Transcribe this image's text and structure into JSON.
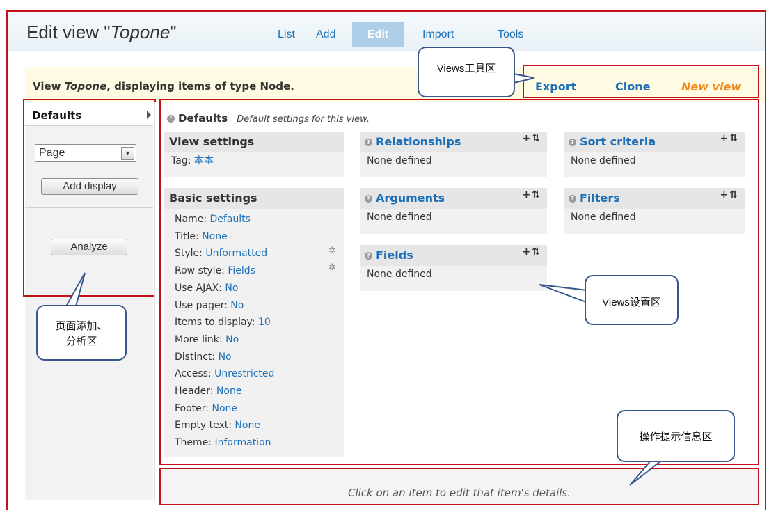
{
  "header": {
    "title_prefix": "Edit view \"",
    "title_name": "Topone",
    "title_suffix": "\"",
    "tabs": [
      {
        "label": "List"
      },
      {
        "label": "Add"
      },
      {
        "label": "Edit"
      },
      {
        "label": "Import"
      },
      {
        "label": "Tools"
      }
    ]
  },
  "infobar": {
    "text_prefix": "View ",
    "view_name": "Topone",
    "text_suffix": ", displaying items of type Node."
  },
  "toolbar": {
    "export_label": "Export",
    "clone_label": "Clone",
    "new_view_label": "New view"
  },
  "sidebar": {
    "tab_label": "Defaults",
    "display_select_value": "Page",
    "add_display_label": "Add display",
    "analyze_label": "Analyze"
  },
  "defaults_header": {
    "title": "Defaults",
    "description": "Default settings for this view."
  },
  "view_settings": {
    "title": "View settings",
    "tag_label": "Tag: ",
    "tag_value": "本本"
  },
  "basic_settings": {
    "title": "Basic settings",
    "items": [
      {
        "label": "Name: ",
        "value": "Defaults"
      },
      {
        "label": "Title: ",
        "value": "None"
      },
      {
        "label": "Style: ",
        "value": "Unformatted"
      },
      {
        "label": "Row style: ",
        "value": "Fields"
      },
      {
        "label": "Use AJAX: ",
        "value": "No"
      },
      {
        "label": "Use pager: ",
        "value": "No"
      },
      {
        "label": "Items to display: ",
        "value": "10"
      },
      {
        "label": "More link: ",
        "value": "No"
      },
      {
        "label": "Distinct: ",
        "value": "No"
      },
      {
        "label": "Access: ",
        "value": "Unrestricted"
      },
      {
        "label": "Header: ",
        "value": "None"
      },
      {
        "label": "Footer: ",
        "value": "None"
      },
      {
        "label": "Empty text: ",
        "value": "None"
      },
      {
        "label": "Theme: ",
        "value": "Information"
      }
    ]
  },
  "sections": {
    "relationships": {
      "title": "Relationships",
      "body": "None defined"
    },
    "arguments": {
      "title": "Arguments",
      "body": "None defined"
    },
    "fields": {
      "title": "Fields",
      "body": "None defined"
    },
    "sort_criteria": {
      "title": "Sort criteria",
      "body": "None defined"
    },
    "filters": {
      "title": "Filters",
      "body": "None defined"
    }
  },
  "callouts": {
    "toolbar_area": "Views工具区",
    "add_analyze_area_line1": "页面添加、",
    "add_analyze_area_line2": "分析区",
    "settings_area": "Views设置区",
    "hint_area": "操作提示信息区"
  },
  "footer": {
    "hint": "Click on an item to edit that item's details."
  },
  "colors": {
    "annotation_red": "#c8101a",
    "link_blue": "#1d6fb7",
    "new_view_orange": "#f08c20",
    "callout_border": "#37568a"
  }
}
